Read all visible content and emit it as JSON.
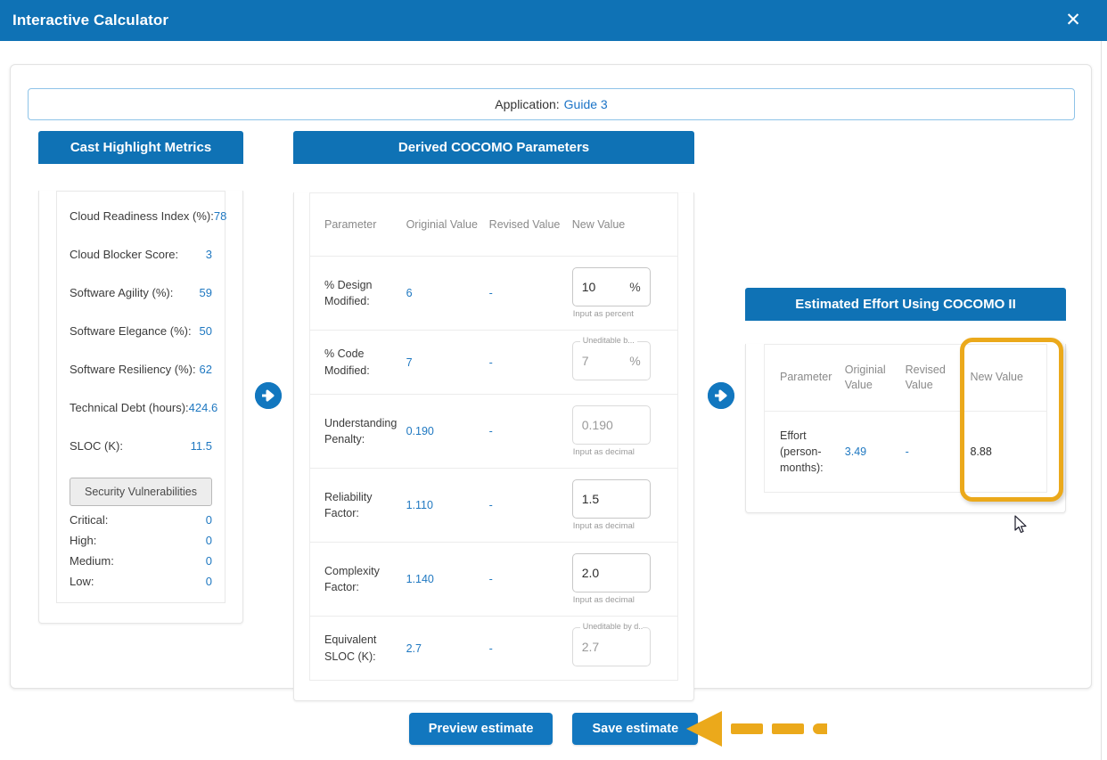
{
  "window": {
    "title": "Interactive Calculator",
    "close_label": "✕"
  },
  "app_bar": {
    "label": "Application:",
    "app_name": "Guide 3"
  },
  "metrics_panel": {
    "header": "Cast Highlight Metrics",
    "rows": [
      {
        "label": "Cloud Readiness Index (%):",
        "value": "78"
      },
      {
        "label": "Cloud Blocker Score:",
        "value": "3"
      },
      {
        "label": "Software Agility (%):",
        "value": "59"
      },
      {
        "label": "Software Elegance (%):",
        "value": "50"
      },
      {
        "label": "Software Resiliency (%):",
        "value": "62"
      },
      {
        "label": "Technical Debt (hours):",
        "value": "424.6"
      },
      {
        "label": "SLOC (K):",
        "value": "11.5"
      }
    ],
    "security_button": "Security Vulnerabilities",
    "security_rows": [
      {
        "label": "Critical:",
        "value": "0"
      },
      {
        "label": "High:",
        "value": "0"
      },
      {
        "label": "Medium:",
        "value": "0"
      },
      {
        "label": "Low:",
        "value": "0"
      }
    ]
  },
  "cocomo_panel": {
    "header": "Derived COCOMO Parameters",
    "columns": [
      "Parameter",
      "Originial Value",
      "Revised Value",
      "New Value"
    ],
    "rows": [
      {
        "parameter": "% Design Modified:",
        "original": "6",
        "revised": "-",
        "new_value": "10",
        "unit": "%",
        "hint": "Input as percent",
        "float_label": "",
        "disabled": false
      },
      {
        "parameter": "% Code Modified:",
        "original": "7",
        "revised": "-",
        "new_value": "7",
        "unit": "%",
        "hint": "",
        "float_label": "Uneditable b...",
        "disabled": true
      },
      {
        "parameter": "Understanding Penalty:",
        "original": "0.190",
        "revised": "-",
        "new_value": "0.190",
        "unit": "",
        "hint": "Input as decimal",
        "float_label": "",
        "disabled": true
      },
      {
        "parameter": "Reliability Factor:",
        "original": "1.110",
        "revised": "-",
        "new_value": "1.5",
        "unit": "",
        "hint": "Input as decimal",
        "float_label": "",
        "disabled": false
      },
      {
        "parameter": "Complexity Factor:",
        "original": "1.140",
        "revised": "-",
        "new_value": "2.0",
        "unit": "",
        "hint": "Input as decimal",
        "float_label": "",
        "disabled": false
      },
      {
        "parameter": "Equivalent SLOC (K):",
        "original": "2.7",
        "revised": "-",
        "new_value": "2.7",
        "unit": "",
        "hint": "",
        "float_label": "Uneditable by d...",
        "disabled": true
      }
    ]
  },
  "effort_panel": {
    "header": "Estimated Effort Using COCOMO II",
    "columns": [
      "Parameter",
      "Originial Value",
      "Revised Value",
      "New Value"
    ],
    "rows": [
      {
        "parameter": "Effort (person-months):",
        "original": "3.49",
        "revised": "-",
        "new_value": "8.88"
      }
    ]
  },
  "buttons": {
    "preview": "Preview estimate",
    "save": "Save estimate"
  },
  "colors": {
    "brand_blue": "#0f72b5",
    "button_blue": "#1277bf",
    "link_blue": "#1a73c7",
    "value_blue": "#1f78c1",
    "annotation_orange": "#eba91b",
    "muted_grey": "#8a8a8a"
  },
  "icons": {
    "close": "close-icon",
    "arrow_right_1": "arrow-right-circle-icon",
    "arrow_right_2": "arrow-right-circle-icon",
    "annotation": "annotation-arrow-left-icon",
    "cursor": "mouse-cursor-icon"
  }
}
